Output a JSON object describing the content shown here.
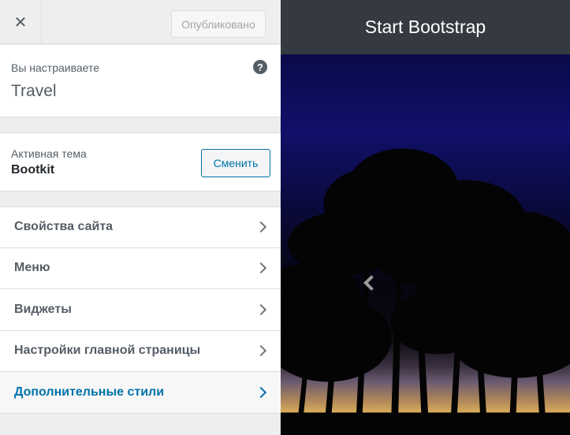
{
  "topbar": {
    "close_symbol": "✕",
    "publish_label": "Опубликовано"
  },
  "info": {
    "label": "Вы настраиваете",
    "title": "Travel",
    "help_symbol": "?"
  },
  "theme": {
    "label": "Активная тема",
    "name": "Bootkit",
    "change_label": "Сменить"
  },
  "menu": {
    "items": [
      {
        "label": "Свойства сайта"
      },
      {
        "label": "Меню"
      },
      {
        "label": "Виджеты"
      },
      {
        "label": "Настройки главной страницы"
      },
      {
        "label": "Дополнительные стили"
      }
    ]
  },
  "preview": {
    "brand": "Start Bootstrap"
  },
  "colors": {
    "accent": "#0073aa",
    "nav_bg": "#343a40"
  }
}
